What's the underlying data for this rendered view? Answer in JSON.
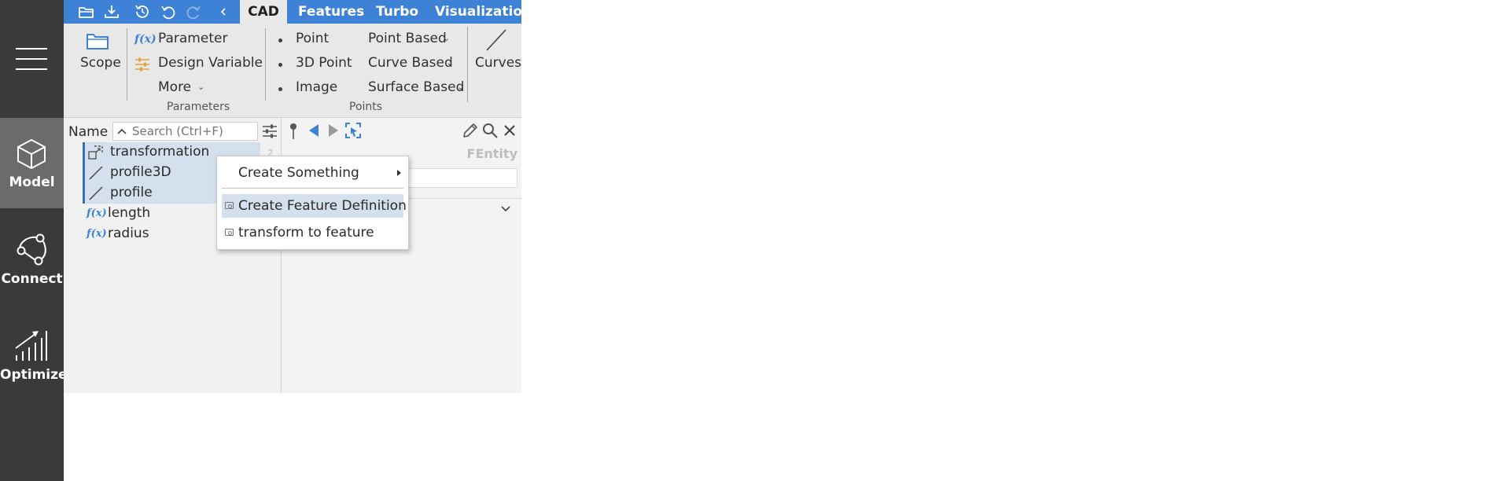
{
  "sidebar": {
    "items": [
      {
        "label": "Model"
      },
      {
        "label": "Connect"
      },
      {
        "label": "Optimize"
      }
    ]
  },
  "tabs": [
    {
      "label": "CAD",
      "active": true
    },
    {
      "label": "Features"
    },
    {
      "label": "Turbo"
    },
    {
      "label": "Visualization"
    }
  ],
  "ribbon": {
    "scope_label": "Scope",
    "parameter_label": "Parameter",
    "design_variable_label": "Design Variable",
    "more_label": "More",
    "parameters_group": "Parameters",
    "point_label": "Point",
    "point3d_label": "3D Point",
    "image_label": "Image",
    "point_based_label": "Point Based",
    "curve_based_label": "Curve Based",
    "surface_based_label": "Surface Based",
    "points_group": "Points",
    "curves_label": "Curves"
  },
  "tree": {
    "name_header": "Name",
    "search_placeholder": "Search (Ctrl+F)",
    "items": [
      {
        "label": "transformation",
        "icon": "transformation-icon",
        "selected": true
      },
      {
        "label": "profile3D",
        "icon": "line-icon",
        "selected": true
      },
      {
        "label": "profile",
        "icon": "line-icon",
        "selected": true
      },
      {
        "label": "length",
        "icon": "fx-icon",
        "selected": false
      },
      {
        "label": "radius",
        "icon": "fx-icon",
        "selected": false
      }
    ],
    "count_badge": "2"
  },
  "properties": {
    "entity_type": "FEntity"
  },
  "context_menu": {
    "items": [
      {
        "label": "Create Something",
        "has_submenu": true
      },
      {
        "label": "Create Feature Definition",
        "highlighted": true
      },
      {
        "label": "transform to feature"
      }
    ]
  },
  "colors": {
    "accent": "#3d82d6",
    "sidebar_bg": "#3a3a3a",
    "sidebar_active": "#6b6b6b",
    "selection": "#d4e0ee"
  }
}
